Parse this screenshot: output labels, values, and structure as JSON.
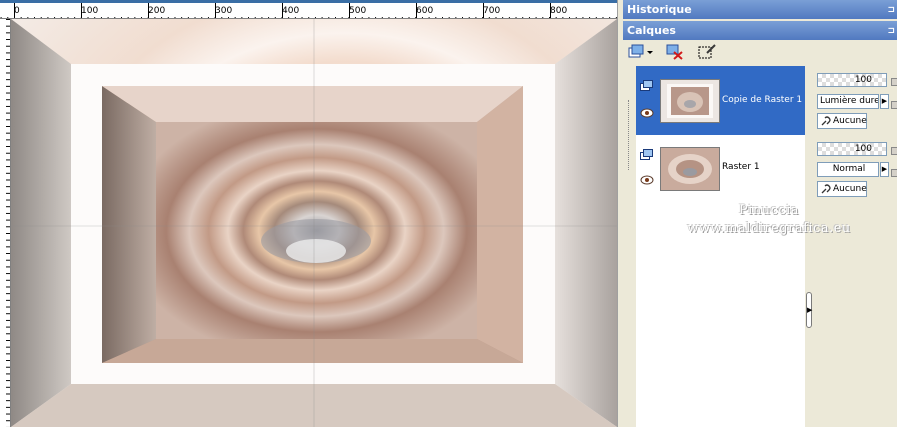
{
  "ruler": {
    "ticks": [
      "0",
      "100",
      "200",
      "300",
      "400",
      "500",
      "600",
      "700",
      "800"
    ]
  },
  "panels": {
    "history_title": "Historique",
    "layers_title": "Calques"
  },
  "layers": [
    {
      "name": "Copie de Raster 1",
      "selected": true,
      "opacity": "100",
      "blend_mode": "Lumière dure",
      "mask_link": "Aucune"
    },
    {
      "name": "Raster 1",
      "selected": false,
      "opacity": "100",
      "blend_mode": "Normal",
      "mask_link": "Aucune"
    }
  ],
  "watermark": {
    "line1": "Pinuccia",
    "line2": "www.maldiregrafica.eu"
  },
  "colors": {
    "title_bar": "#5179c0",
    "selection": "#316ac5",
    "panel_bg": "#ece9d8"
  },
  "icons": [
    "new-layer-icon",
    "delete-layer-icon",
    "edit-selection-icon",
    "layer-type-icon",
    "eye-icon",
    "link-icon"
  ]
}
